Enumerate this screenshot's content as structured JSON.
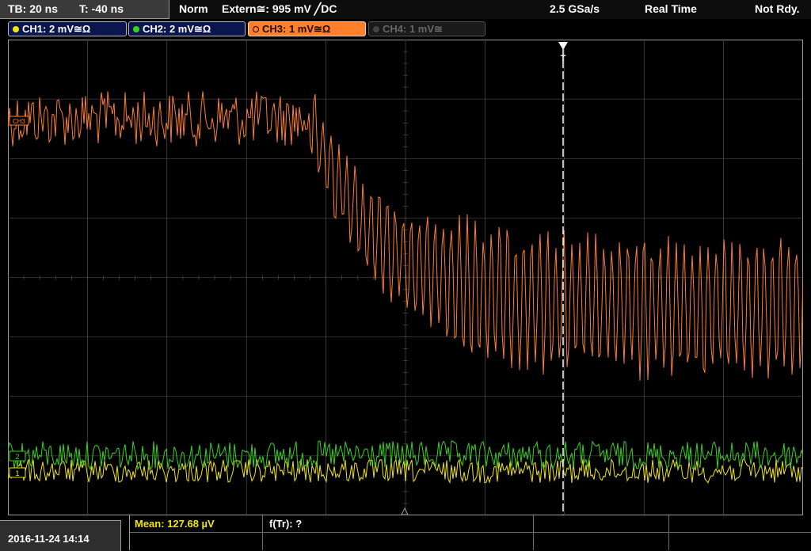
{
  "status_bar": {
    "timebase": "TB: 20 ns",
    "trigger_time": "T: -40 ns",
    "mode": "Norm",
    "trigger_source": "Extern≅: 995 mV ╱DC",
    "sample_rate": "2.5 GSa/s",
    "acquisition": "Real Time",
    "state": "Not Rdy."
  },
  "channels": [
    {
      "label": "CH1: 2 mV≅Ω",
      "color": "#f2e600",
      "state": "on"
    },
    {
      "label": "CH2: 2 mV≅Ω",
      "color": "#39d21a",
      "state": "on"
    },
    {
      "label": "CH3: 1 mV≅Ω",
      "color": "#ff7f2a",
      "state": "selected"
    },
    {
      "label": "CH4: 1 mV≅",
      "color": "#666666",
      "state": "off"
    }
  ],
  "markers": {
    "trigger": "T",
    "ch3_ref": "CH3",
    "ch1_ref": "1",
    "ch2_ref": "2"
  },
  "bottom": {
    "datetime": "2016-11-24 14:14",
    "measurement_1": "Mean: 127.68 µV",
    "measurement_2": "f(Tr): ?"
  },
  "colors": {
    "ch1": "#f2e600",
    "ch2": "#39d21a",
    "ch3": "#ff7f2a",
    "grid": "#5a5a5a",
    "background": "#000000"
  }
}
